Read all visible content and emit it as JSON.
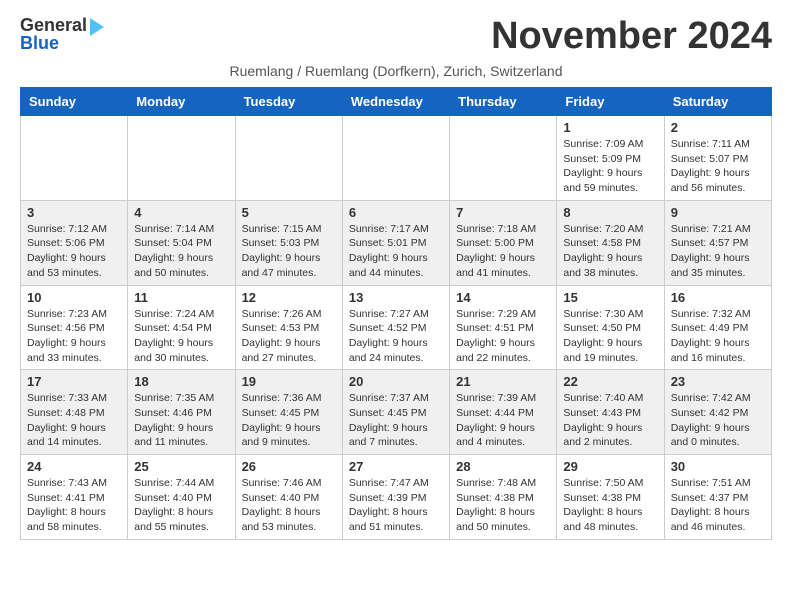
{
  "header": {
    "logo_line1": "General",
    "logo_line2": "Blue",
    "month_title": "November 2024",
    "subtitle": "Ruemlang / Ruemlang (Dorfkern), Zurich, Switzerland"
  },
  "weekdays": [
    "Sunday",
    "Monday",
    "Tuesday",
    "Wednesday",
    "Thursday",
    "Friday",
    "Saturday"
  ],
  "weeks": [
    [
      {
        "day": "",
        "info": ""
      },
      {
        "day": "",
        "info": ""
      },
      {
        "day": "",
        "info": ""
      },
      {
        "day": "",
        "info": ""
      },
      {
        "day": "",
        "info": ""
      },
      {
        "day": "1",
        "info": "Sunrise: 7:09 AM\nSunset: 5:09 PM\nDaylight: 9 hours and 59 minutes."
      },
      {
        "day": "2",
        "info": "Sunrise: 7:11 AM\nSunset: 5:07 PM\nDaylight: 9 hours and 56 minutes."
      }
    ],
    [
      {
        "day": "3",
        "info": "Sunrise: 7:12 AM\nSunset: 5:06 PM\nDaylight: 9 hours and 53 minutes."
      },
      {
        "day": "4",
        "info": "Sunrise: 7:14 AM\nSunset: 5:04 PM\nDaylight: 9 hours and 50 minutes."
      },
      {
        "day": "5",
        "info": "Sunrise: 7:15 AM\nSunset: 5:03 PM\nDaylight: 9 hours and 47 minutes."
      },
      {
        "day": "6",
        "info": "Sunrise: 7:17 AM\nSunset: 5:01 PM\nDaylight: 9 hours and 44 minutes."
      },
      {
        "day": "7",
        "info": "Sunrise: 7:18 AM\nSunset: 5:00 PM\nDaylight: 9 hours and 41 minutes."
      },
      {
        "day": "8",
        "info": "Sunrise: 7:20 AM\nSunset: 4:58 PM\nDaylight: 9 hours and 38 minutes."
      },
      {
        "day": "9",
        "info": "Sunrise: 7:21 AM\nSunset: 4:57 PM\nDaylight: 9 hours and 35 minutes."
      }
    ],
    [
      {
        "day": "10",
        "info": "Sunrise: 7:23 AM\nSunset: 4:56 PM\nDaylight: 9 hours and 33 minutes."
      },
      {
        "day": "11",
        "info": "Sunrise: 7:24 AM\nSunset: 4:54 PM\nDaylight: 9 hours and 30 minutes."
      },
      {
        "day": "12",
        "info": "Sunrise: 7:26 AM\nSunset: 4:53 PM\nDaylight: 9 hours and 27 minutes."
      },
      {
        "day": "13",
        "info": "Sunrise: 7:27 AM\nSunset: 4:52 PM\nDaylight: 9 hours and 24 minutes."
      },
      {
        "day": "14",
        "info": "Sunrise: 7:29 AM\nSunset: 4:51 PM\nDaylight: 9 hours and 22 minutes."
      },
      {
        "day": "15",
        "info": "Sunrise: 7:30 AM\nSunset: 4:50 PM\nDaylight: 9 hours and 19 minutes."
      },
      {
        "day": "16",
        "info": "Sunrise: 7:32 AM\nSunset: 4:49 PM\nDaylight: 9 hours and 16 minutes."
      }
    ],
    [
      {
        "day": "17",
        "info": "Sunrise: 7:33 AM\nSunset: 4:48 PM\nDaylight: 9 hours and 14 minutes."
      },
      {
        "day": "18",
        "info": "Sunrise: 7:35 AM\nSunset: 4:46 PM\nDaylight: 9 hours and 11 minutes."
      },
      {
        "day": "19",
        "info": "Sunrise: 7:36 AM\nSunset: 4:45 PM\nDaylight: 9 hours and 9 minutes."
      },
      {
        "day": "20",
        "info": "Sunrise: 7:37 AM\nSunset: 4:45 PM\nDaylight: 9 hours and 7 minutes."
      },
      {
        "day": "21",
        "info": "Sunrise: 7:39 AM\nSunset: 4:44 PM\nDaylight: 9 hours and 4 minutes."
      },
      {
        "day": "22",
        "info": "Sunrise: 7:40 AM\nSunset: 4:43 PM\nDaylight: 9 hours and 2 minutes."
      },
      {
        "day": "23",
        "info": "Sunrise: 7:42 AM\nSunset: 4:42 PM\nDaylight: 9 hours and 0 minutes."
      }
    ],
    [
      {
        "day": "24",
        "info": "Sunrise: 7:43 AM\nSunset: 4:41 PM\nDaylight: 8 hours and 58 minutes."
      },
      {
        "day": "25",
        "info": "Sunrise: 7:44 AM\nSunset: 4:40 PM\nDaylight: 8 hours and 55 minutes."
      },
      {
        "day": "26",
        "info": "Sunrise: 7:46 AM\nSunset: 4:40 PM\nDaylight: 8 hours and 53 minutes."
      },
      {
        "day": "27",
        "info": "Sunrise: 7:47 AM\nSunset: 4:39 PM\nDaylight: 8 hours and 51 minutes."
      },
      {
        "day": "28",
        "info": "Sunrise: 7:48 AM\nSunset: 4:38 PM\nDaylight: 8 hours and 50 minutes."
      },
      {
        "day": "29",
        "info": "Sunrise: 7:50 AM\nSunset: 4:38 PM\nDaylight: 8 hours and 48 minutes."
      },
      {
        "day": "30",
        "info": "Sunrise: 7:51 AM\nSunset: 4:37 PM\nDaylight: 8 hours and 46 minutes."
      }
    ]
  ]
}
